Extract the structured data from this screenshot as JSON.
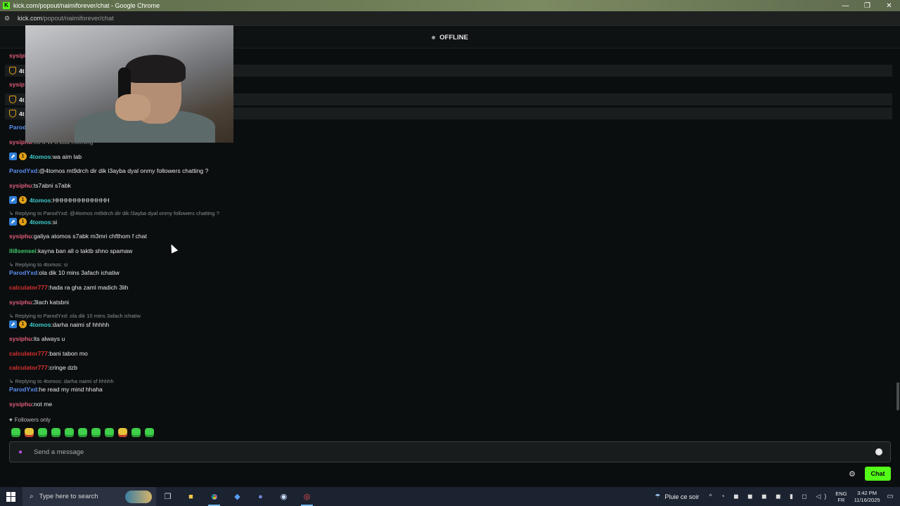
{
  "browser": {
    "title": "kick.com/popout/naimiforever/chat - Google Chrome",
    "favicon_text": "K",
    "url_host": "kick.com",
    "url_path": "/popout/naimiforever/chat",
    "win_min": "—",
    "win_restore": "❐",
    "win_close": "✕"
  },
  "header": {
    "status": "OFFLINE"
  },
  "pinned_rows": [
    {
      "user": "sysiphu",
      "color": "#e05c7a"
    },
    {
      "user": "4t",
      "color": "#ffffff"
    },
    {
      "user": "sysip",
      "color": "#e05c7a"
    },
    {
      "user": "4t",
      "color": "#ffffff"
    },
    {
      "user": "4t",
      "color": "#ffffff"
    },
    {
      "user": "Parod",
      "color": "#5b8ef0"
    }
  ],
  "messages": [
    {
      "user": "sysiphu",
      "sep": ": ",
      "text": "3a a W a bad morning",
      "color": "#e05c7a"
    },
    {
      "user": "4tomos",
      "sep": ": ",
      "text": "wa aim lab",
      "color": "#3ec9c9",
      "badges": [
        "boost",
        "sub"
      ]
    },
    {
      "user": "ParodYxd",
      "sep": ": ",
      "text": "@4tomos mt9drch dir dik l3ayba dyal onmy followers chatting ?",
      "color": "#5b8ef0"
    },
    {
      "user": "sysiphu",
      "sep": ": ",
      "text": "ts7abni s7abk",
      "color": "#e05c7a"
    },
    {
      "user": "4tomos",
      "sep": ": ",
      "text": "HHHHHHHHHHHHH",
      "color": "#3ec9c9",
      "badges": [
        "boost",
        "sub"
      ]
    },
    {
      "reply": "Replying to ParodYxd: @4tomos mt9drch dir dik l3ayba dyal onmy followers chatting ?"
    },
    {
      "user": "4tomos",
      "sep": ": ",
      "text": "si",
      "color": "#3ec9c9",
      "badges": [
        "boost",
        "sub"
      ]
    },
    {
      "user": "sysiphu",
      "sep": ": ",
      "text": "galiya atomos s7abk m3mri chfthom f chat",
      "color": "#e05c7a"
    },
    {
      "user": "lli8sensei",
      "sep": ": ",
      "text": "kayna ban all o taktb shno spamaw",
      "color": "#3ec96a"
    },
    {
      "reply": "Replying to 4tomos: si"
    },
    {
      "user": "ParodYxd",
      "sep": ": ",
      "text": "ola dik 10 mins 3afach ichatiw",
      "color": "#5b8ef0"
    },
    {
      "user": "calculator777",
      "sep": ": ",
      "text": "hada ra gha zaml madich 3lih",
      "color": "#d8302f"
    },
    {
      "user": "sysiphu",
      "sep": ": ",
      "text": "3lach katsbni",
      "color": "#e05c7a"
    },
    {
      "reply": "Replying to ParodYxd: ola dik 10 mins 3afach ichatiw"
    },
    {
      "user": "4tomos",
      "sep": ": ",
      "text": "darha naimi sf hhhhh",
      "color": "#3ec9c9",
      "badges": [
        "boost",
        "sub"
      ]
    },
    {
      "user": "sysiphu",
      "sep": ": ",
      "text": "its always u",
      "color": "#e05c7a"
    },
    {
      "user": "calculator777",
      "sep": ": ",
      "text": "bani tabon mo",
      "color": "#d8302f"
    },
    {
      "user": "calculator777",
      "sep": ": ",
      "text": "cringe dzb",
      "color": "#d8302f"
    },
    {
      "reply": "Replying to 4tomos: darha naimi sf hhhhh"
    },
    {
      "user": "ParodYxd",
      "sep": ": ",
      "text": "he read my mind hhaha",
      "color": "#5b8ef0"
    },
    {
      "user": "sysiphu",
      "sep": ": ",
      "text": "not me",
      "color": "#e05c7a"
    }
  ],
  "footer": {
    "followers_only": "Followers only",
    "input_placeholder": "Send a message",
    "chat_button": "Chat"
  },
  "taskbar": {
    "search_text": "Type here to search",
    "weather": "Pluie ce soir",
    "lang_top": "ENG",
    "lang_bottom": "FR",
    "time": "3:42 PM",
    "date": "11/16/2025"
  },
  "icons": {
    "search": "search-icon",
    "mic": "microphone-icon",
    "emoji": "emoji-icon",
    "settings": "gear-icon"
  }
}
